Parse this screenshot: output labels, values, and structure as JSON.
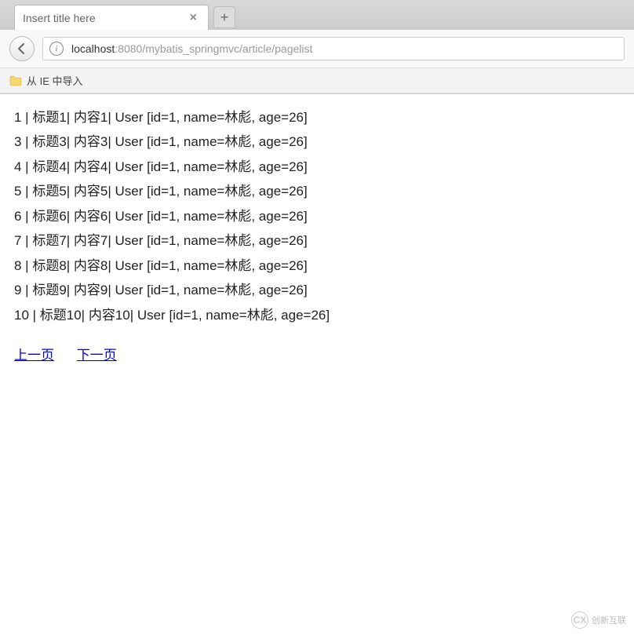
{
  "tab": {
    "title": "Insert title here",
    "close_label": "×",
    "new_tab_label": "+"
  },
  "url": {
    "info_symbol": "i",
    "host": "localhost",
    "port": ":8080",
    "path": "/mybatis_springmvc/article/pagelist"
  },
  "bookmarks": {
    "item1": "从 IE 中导入"
  },
  "articles": [
    {
      "id": "1",
      "title": "标题1",
      "content": "内容1",
      "user": "User [id=1, name=林彪, age=26]"
    },
    {
      "id": "3",
      "title": "标题3",
      "content": "内容3",
      "user": "User [id=1, name=林彪, age=26]"
    },
    {
      "id": "4",
      "title": "标题4",
      "content": "内容4",
      "user": "User [id=1, name=林彪, age=26]"
    },
    {
      "id": "5",
      "title": "标题5",
      "content": "内容5",
      "user": "User [id=1, name=林彪, age=26]"
    },
    {
      "id": "6",
      "title": "标题6",
      "content": "内容6",
      "user": "User [id=1, name=林彪, age=26]"
    },
    {
      "id": "7",
      "title": "标题7",
      "content": "内容7",
      "user": "User [id=1, name=林彪, age=26]"
    },
    {
      "id": "8",
      "title": "标题8",
      "content": "内容8",
      "user": "User [id=1, name=林彪, age=26]"
    },
    {
      "id": "9",
      "title": "标题9",
      "content": "内容9",
      "user": "User [id=1, name=林彪, age=26]"
    },
    {
      "id": "10",
      "title": "标题10",
      "content": "内容10",
      "user": "User [id=1, name=林彪, age=26]"
    }
  ],
  "pagination": {
    "prev_label": "上一页",
    "next_label": "下一页"
  },
  "watermark": {
    "logo_text": "CX",
    "text": "创新互联"
  }
}
